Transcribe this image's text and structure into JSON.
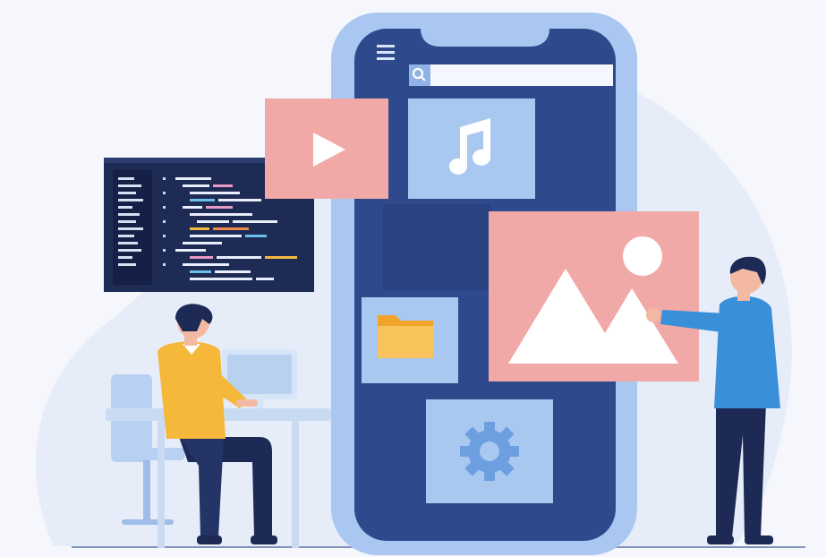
{
  "illustration": {
    "kind": "mobile app development illustration",
    "colors": {
      "background": "#f5f7fc",
      "blob": "#e6ecf7",
      "phone_frame": "#a9c7f0",
      "phone_screen": "#2f4a8c",
      "tile_light": "#a8c8f0",
      "tile_pink": "#f1a9a7",
      "folder": "#f5b942",
      "code_panel": "#1e2b55",
      "shirt_yellow": "#f5b83b",
      "shirt_blue": "#3a8fd9",
      "pants": "#1c2a55",
      "skin": "#f3b9a3",
      "hair": "#1c2a55"
    },
    "icons": [
      "menu-icon",
      "search-icon",
      "play-icon",
      "music-note-icon",
      "image-icon",
      "folder-icon",
      "gear-icon"
    ]
  }
}
